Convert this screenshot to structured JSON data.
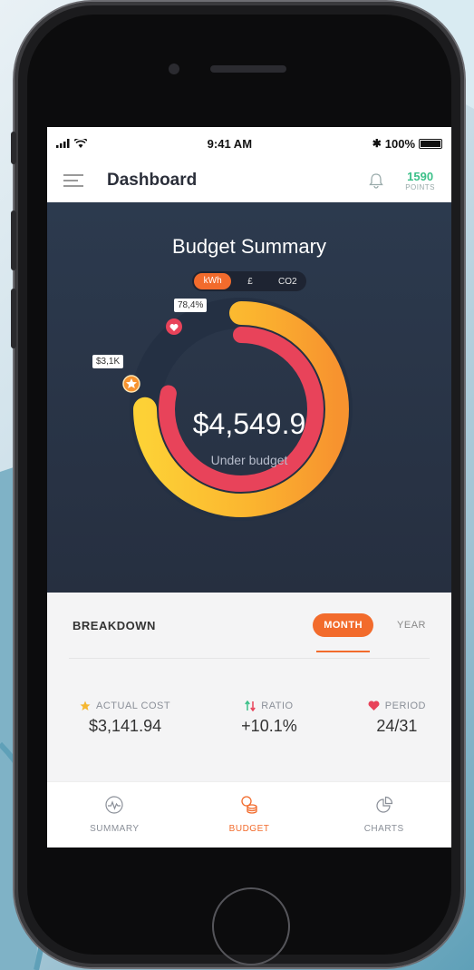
{
  "status_bar": {
    "time": "9:41 AM",
    "battery": "100%"
  },
  "header": {
    "title": "Dashboard",
    "points_value": "1590",
    "points_label": "POINTS"
  },
  "summary": {
    "title": "Budget Summary",
    "units": [
      "kWh",
      "£",
      "CO2"
    ],
    "active_unit": "kWh",
    "center_value": "$4,549.9",
    "center_label": "Under budget",
    "tag_inner": "78,4%",
    "tag_outer": "$3,1K",
    "inner_ring_fraction": 0.784,
    "outer_ring_fraction": 0.75
  },
  "breakdown": {
    "title": "BREAKDOWN",
    "tabs": [
      "MONTH",
      "YEAR"
    ],
    "active_tab": "MONTH",
    "metrics": [
      {
        "label": "ACTUAL COST",
        "value": "$3,141.94",
        "icon": "star-icon"
      },
      {
        "label": "RATIO",
        "value": "+10.1%",
        "icon": "up-down-arrows-icon"
      },
      {
        "label": "PERIOD",
        "value": "24/31",
        "icon": "heart-icon"
      }
    ]
  },
  "tabbar": {
    "items": [
      {
        "label": "SUMMARY",
        "icon": "pulse-icon"
      },
      {
        "label": "BUDGET",
        "icon": "coins-icon"
      },
      {
        "label": "CHARTS",
        "icon": "pie-chart-icon"
      }
    ],
    "active": "BUDGET"
  },
  "colors": {
    "accent": "#f26b2c",
    "ring_red": "#e8435a",
    "ring_yellow": "#fbc531",
    "ring_orange": "#f7932f",
    "points_green": "#3cc089",
    "panel_dark": "#2c3a4e"
  }
}
